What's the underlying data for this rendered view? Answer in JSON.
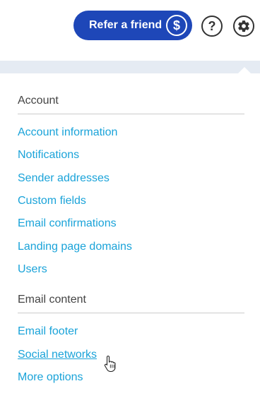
{
  "header": {
    "refer_label": "Refer a friend",
    "refer_badge": "$",
    "help_glyph": "?",
    "icons": {
      "refer": "dollar-icon",
      "help": "question-mark-icon",
      "settings": "gear-icon"
    }
  },
  "colors": {
    "brand_blue": "#1e47b8",
    "link": "#1aa3d9",
    "band": "#e5ebf3"
  },
  "menu": {
    "account": {
      "title": "Account",
      "items": [
        "Account information",
        "Notifications",
        "Sender addresses",
        "Custom fields",
        "Email confirmations",
        "Landing page domains",
        "Users"
      ]
    },
    "email_content": {
      "title": "Email content",
      "items": [
        "Email footer",
        "Social networks",
        "More options"
      ]
    }
  }
}
